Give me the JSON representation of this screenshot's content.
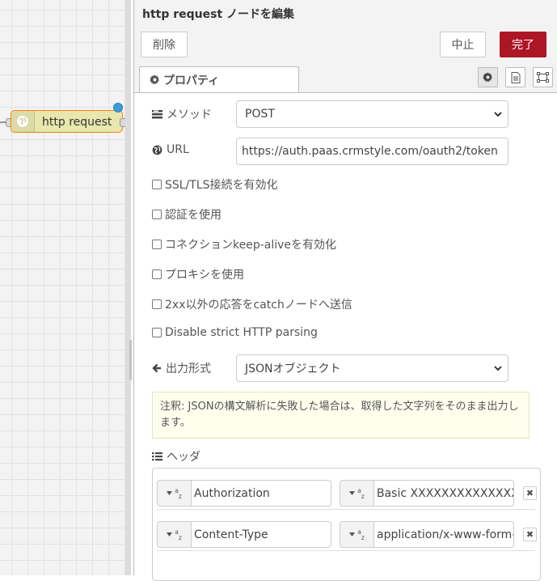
{
  "workspace": {
    "node": {
      "label": "http request",
      "color": "#e7e7ae",
      "border_color": "#ff7f0e",
      "icon": "globe-icon"
    },
    "changed_indicator_color": "#3a9fd8"
  },
  "tray": {
    "title": "http request ノードを編集",
    "buttons": {
      "delete": "削除",
      "cancel": "中止",
      "done": "完了"
    },
    "done_color": "#ad1625",
    "tabs": [
      {
        "label": "プロパティ",
        "icon": "gear-icon"
      }
    ],
    "tab_icons": [
      "gear-icon",
      "description-icon",
      "appearance-icon"
    ]
  },
  "form": {
    "method": {
      "label": "メソッド",
      "icon": "list-icon",
      "value": "POST"
    },
    "url": {
      "label": "URL",
      "icon": "globe-icon",
      "value": "https://auth.paas.crmstyle.com/oauth2/token"
    },
    "checkboxes": [
      {
        "label": "SSL/TLS接続を有効化",
        "checked": false
      },
      {
        "label": "認証を使用",
        "checked": false
      },
      {
        "label": "コネクションkeep-aliveを有効化",
        "checked": false
      },
      {
        "label": "プロキシを使用",
        "checked": false
      },
      {
        "label": "2xx以外の応答をcatchノードへ送信",
        "checked": false
      },
      {
        "label": "Disable strict HTTP parsing",
        "checked": false
      }
    ],
    "output": {
      "label": "出力形式",
      "icon": "arrow-left-icon",
      "value": "JSONオブジェクト"
    },
    "tip": "注釈: JSONの構文解析に失敗した場合は、取得した文字列をそのまま出力します。",
    "headers": {
      "label": "ヘッダ",
      "icon": "list-icon",
      "rows": [
        {
          "name": "Authorization",
          "value": "Basic XXXXXXXXXXXXXXXXXX"
        },
        {
          "name": "Content-Type",
          "value": "application/x-www-form-urlencoded"
        }
      ]
    }
  }
}
